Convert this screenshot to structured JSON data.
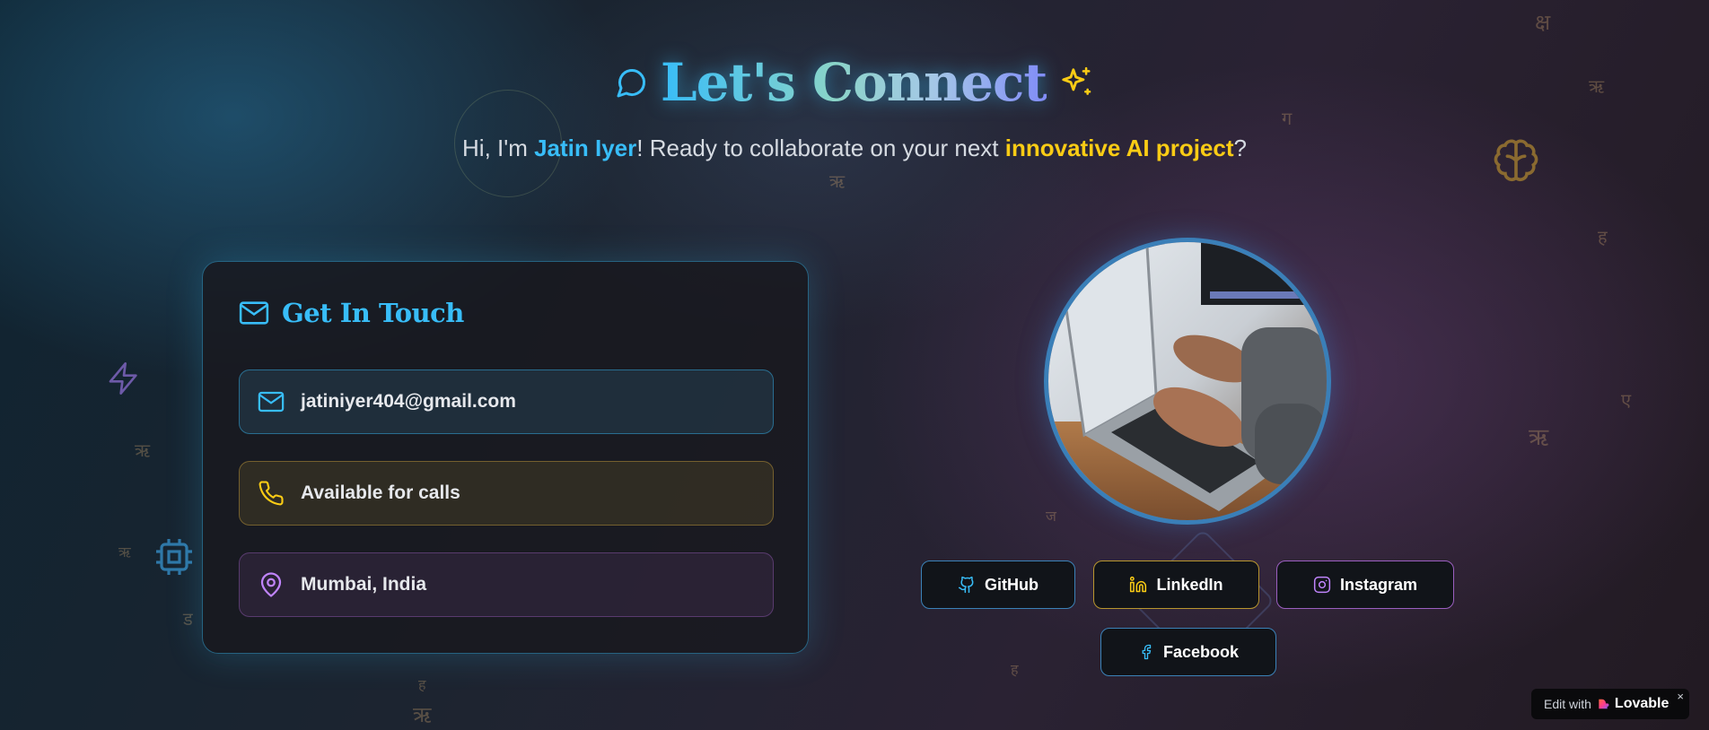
{
  "header": {
    "title": "Let's Connect",
    "subtitle_prefix": "Hi, I'm ",
    "subtitle_name": "Jatin Iyer",
    "subtitle_mid": "! Ready to collaborate on your next ",
    "subtitle_highlight": "innovative AI project",
    "subtitle_suffix": "?"
  },
  "contact_card": {
    "title": "Get In Touch",
    "items": [
      {
        "icon": "mail-icon",
        "text": "jatiniyer404@gmail.com"
      },
      {
        "icon": "phone-icon",
        "text": "Available for calls"
      },
      {
        "icon": "map-pin-icon",
        "text": "Mumbai, India"
      }
    ]
  },
  "social": [
    {
      "icon": "github-icon",
      "label": "GitHub"
    },
    {
      "icon": "linkedin-icon",
      "label": "LinkedIn"
    },
    {
      "icon": "instagram-icon",
      "label": "Instagram"
    },
    {
      "icon": "facebook-icon",
      "label": "Facebook"
    }
  ],
  "badge": {
    "prefix": "Edit with",
    "brand": "Lovable",
    "close": "×"
  },
  "decor_glyphs": [
    "क्ष",
    "ऋ",
    "ग",
    "ऋ",
    "ह",
    "ए",
    "ऋ",
    "ऋ",
    "ऋ",
    "ड",
    "ज",
    "ह",
    "ह",
    "ऋ"
  ],
  "colors": {
    "accent_blue": "#38bdf8",
    "accent_gold": "#facc15",
    "accent_purple": "#c084fc"
  }
}
